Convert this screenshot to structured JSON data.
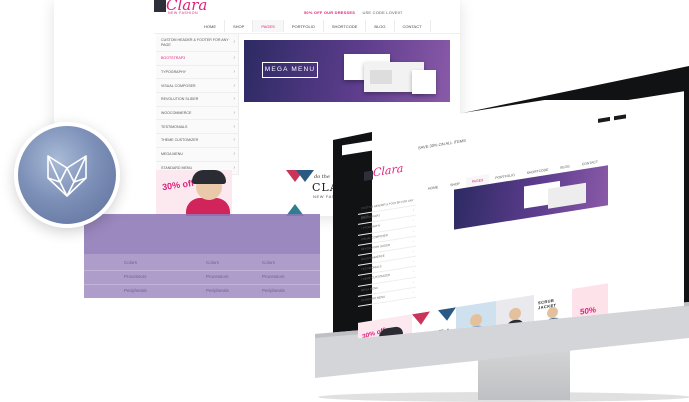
{
  "back_site": {
    "promo": {
      "highlight": "50% OFF OUR DRESSES",
      "code": "USE CODE LOVE07"
    },
    "logo": {
      "word": "Clara",
      "tagline": "NEW FASHION"
    },
    "nav": [
      "HOME",
      "SHOP",
      "PAGES",
      "PORTFOLIO",
      "SHORTCODE",
      "BLOG",
      "CONTACT"
    ],
    "nav_active": "PAGES",
    "menu": [
      "CUSTOM HEADER & FOOTER FOR ANY PAGE",
      "BOOTSTRAP3",
      "TYPOGRAPHY",
      "VISUAL COMPOSER",
      "REVOLUTION SLIDER",
      "WOOCOMMERCE",
      "TESTIMONIALS",
      "THEME CUSTOMIZER",
      "MEGA MENU",
      "STANDARD MENU"
    ],
    "menu_active_index": 1,
    "banner_label": "MEGA MENU",
    "promo_tile": {
      "discount": "30% off"
    },
    "clara_tile": {
      "line1": "do the",
      "line2": "CLARA",
      "line3": "NEW FASHION"
    }
  },
  "table_overlay": {
    "rows": [
      [
        "Colors",
        "Colors",
        "Colors"
      ],
      [
        "Processors",
        "Processors",
        "Processors"
      ],
      [
        "Peripherals",
        "Peripherals",
        "Peripherals"
      ]
    ]
  },
  "imac_site": {
    "promo": "SAVE 30% ON ALL ITEMS",
    "logo": {
      "word": "Clara"
    },
    "nav": [
      "HOME",
      "SHOP",
      "PAGES",
      "PORTFOLIO",
      "SHORTCODE",
      "BLOG",
      "CONTACT"
    ],
    "nav_active": "PAGES",
    "tiles": {
      "a": "30% off",
      "b": "CLARA",
      "e": "SCRUB JACKET",
      "f": "50%"
    }
  },
  "colors": {
    "accent": "#e0217d",
    "banner_dark": "#2c2a63",
    "overlay": "#9c86bf",
    "badge": "#7d90b8"
  },
  "icons": {
    "badge": "geometric-fox-logo-icon",
    "chevron": "chevron-right-icon"
  }
}
